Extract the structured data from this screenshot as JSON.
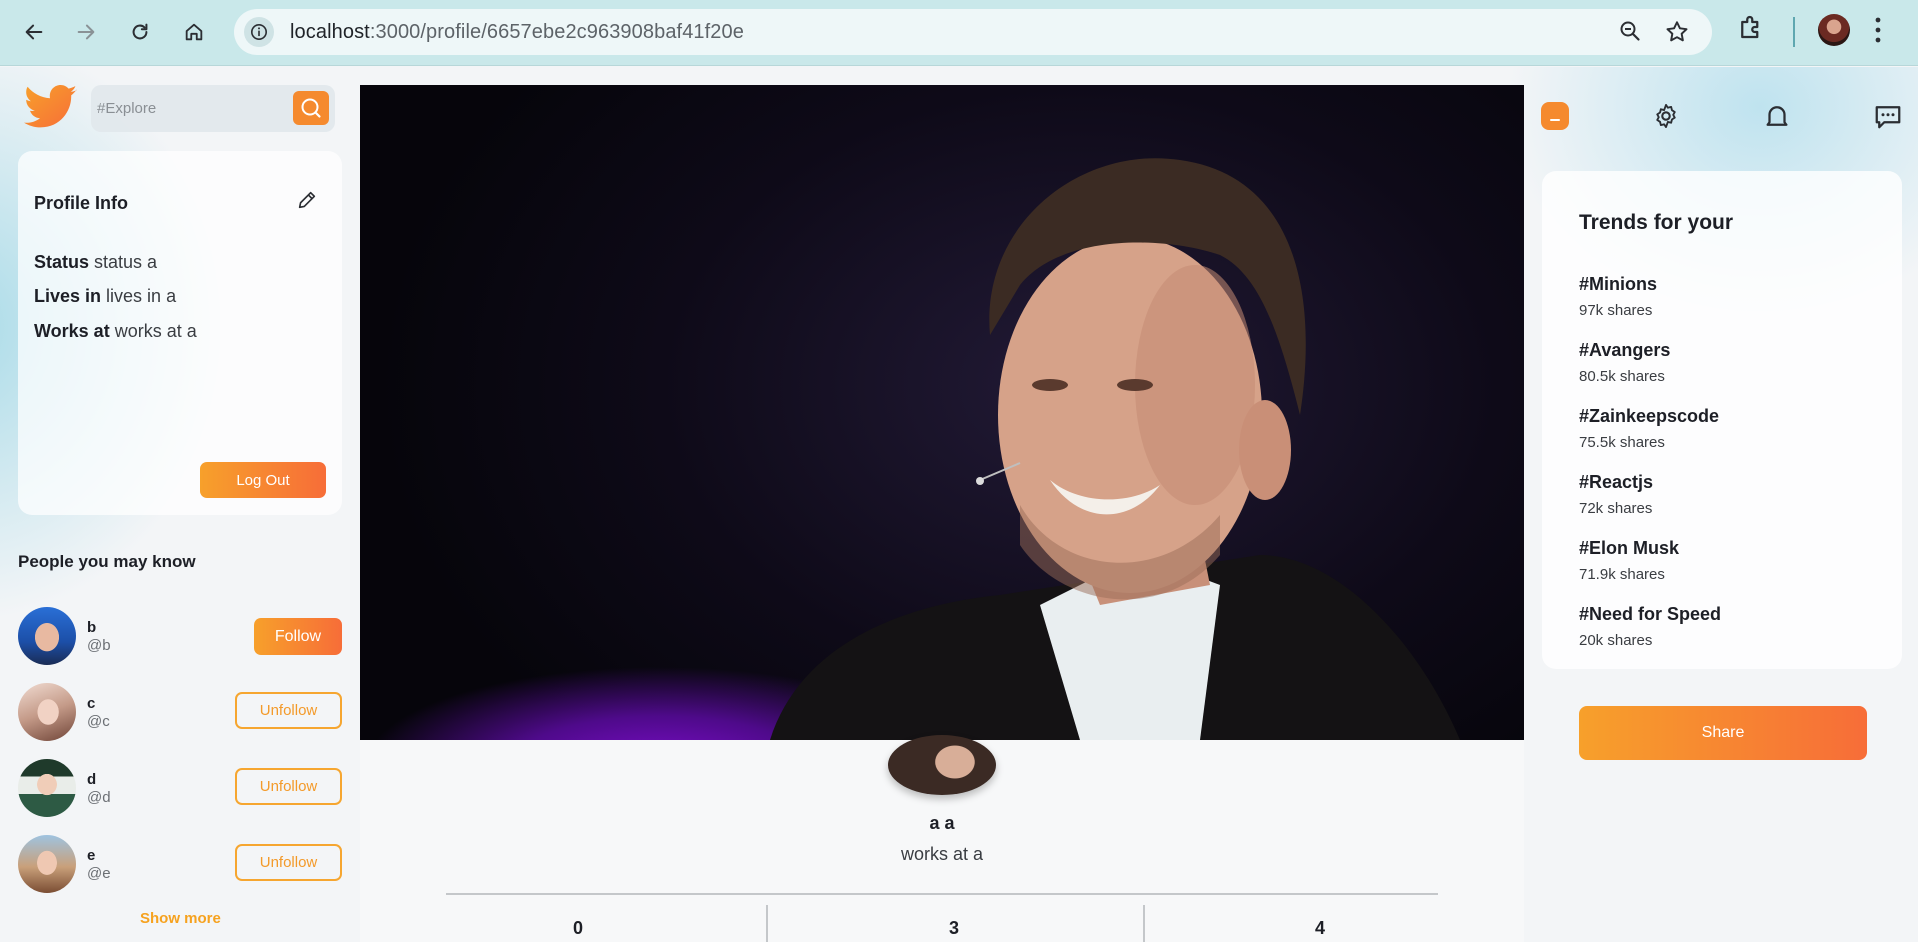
{
  "browser": {
    "url_host": "localhost",
    "url_rest": ":3000/profile/6657ebe2c963908baf41f20e"
  },
  "search": {
    "placeholder": "#Explore"
  },
  "profile_info": {
    "title": "Profile Info",
    "rows": [
      {
        "label": "Status",
        "value": "status a"
      },
      {
        "label": "Lives in",
        "value": "lives in a"
      },
      {
        "label": "Works at",
        "value": "works at a"
      }
    ],
    "logout_label": "Log Out"
  },
  "people": {
    "title": "People you may know",
    "items": [
      {
        "name": "b",
        "handle": "@b",
        "action": "Follow"
      },
      {
        "name": "c",
        "handle": "@c",
        "action": "Unfollow"
      },
      {
        "name": "d",
        "handle": "@d",
        "action": "Unfollow"
      },
      {
        "name": "e",
        "handle": "@e",
        "action": "Unfollow"
      }
    ],
    "show_more": "Show more"
  },
  "profile": {
    "name": "a a",
    "work": "works at a",
    "stats": [
      "0",
      "3",
      "4"
    ]
  },
  "trends": {
    "title": "Trends for your",
    "items": [
      {
        "tag": "#Minions",
        "count": "97k shares"
      },
      {
        "tag": "#Avangers",
        "count": "80.5k shares"
      },
      {
        "tag": "#Zainkeepscode",
        "count": "75.5k shares"
      },
      {
        "tag": "#Reactjs",
        "count": "72k shares"
      },
      {
        "tag": "#Elon Musk",
        "count": "71.9k shares"
      },
      {
        "tag": "#Need for Speed",
        "count": "20k shares"
      }
    ]
  },
  "share_label": "Share",
  "colors": {
    "accent": "#f58a2e",
    "accent_end": "#f76d38",
    "outline": "#f6a630"
  }
}
